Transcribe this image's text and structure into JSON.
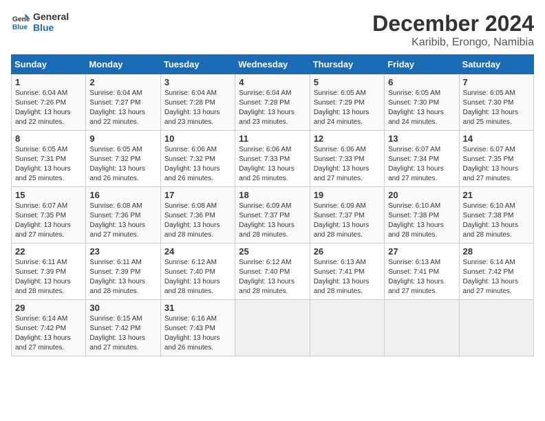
{
  "header": {
    "logo_line1": "General",
    "logo_line2": "Blue",
    "month": "December 2024",
    "location": "Karibib, Erongo, Namibia"
  },
  "weekdays": [
    "Sunday",
    "Monday",
    "Tuesday",
    "Wednesday",
    "Thursday",
    "Friday",
    "Saturday"
  ],
  "weeks": [
    [
      {
        "day": "1",
        "info": "Sunrise: 6:04 AM\nSunset: 7:26 PM\nDaylight: 13 hours\nand 22 minutes."
      },
      {
        "day": "2",
        "info": "Sunrise: 6:04 AM\nSunset: 7:27 PM\nDaylight: 13 hours\nand 22 minutes."
      },
      {
        "day": "3",
        "info": "Sunrise: 6:04 AM\nSunset: 7:28 PM\nDaylight: 13 hours\nand 23 minutes."
      },
      {
        "day": "4",
        "info": "Sunrise: 6:04 AM\nSunset: 7:28 PM\nDaylight: 13 hours\nand 23 minutes."
      },
      {
        "day": "5",
        "info": "Sunrise: 6:05 AM\nSunset: 7:29 PM\nDaylight: 13 hours\nand 24 minutes."
      },
      {
        "day": "6",
        "info": "Sunrise: 6:05 AM\nSunset: 7:30 PM\nDaylight: 13 hours\nand 24 minutes."
      },
      {
        "day": "7",
        "info": "Sunrise: 6:05 AM\nSunset: 7:30 PM\nDaylight: 13 hours\nand 25 minutes."
      }
    ],
    [
      {
        "day": "8",
        "info": "Sunrise: 6:05 AM\nSunset: 7:31 PM\nDaylight: 13 hours\nand 25 minutes."
      },
      {
        "day": "9",
        "info": "Sunrise: 6:05 AM\nSunset: 7:32 PM\nDaylight: 13 hours\nand 26 minutes."
      },
      {
        "day": "10",
        "info": "Sunrise: 6:06 AM\nSunset: 7:32 PM\nDaylight: 13 hours\nand 26 minutes."
      },
      {
        "day": "11",
        "info": "Sunrise: 6:06 AM\nSunset: 7:33 PM\nDaylight: 13 hours\nand 26 minutes."
      },
      {
        "day": "12",
        "info": "Sunrise: 6:06 AM\nSunset: 7:33 PM\nDaylight: 13 hours\nand 27 minutes."
      },
      {
        "day": "13",
        "info": "Sunrise: 6:07 AM\nSunset: 7:34 PM\nDaylight: 13 hours\nand 27 minutes."
      },
      {
        "day": "14",
        "info": "Sunrise: 6:07 AM\nSunset: 7:35 PM\nDaylight: 13 hours\nand 27 minutes."
      }
    ],
    [
      {
        "day": "15",
        "info": "Sunrise: 6:07 AM\nSunset: 7:35 PM\nDaylight: 13 hours\nand 27 minutes."
      },
      {
        "day": "16",
        "info": "Sunrise: 6:08 AM\nSunset: 7:36 PM\nDaylight: 13 hours\nand 27 minutes."
      },
      {
        "day": "17",
        "info": "Sunrise: 6:08 AM\nSunset: 7:36 PM\nDaylight: 13 hours\nand 28 minutes."
      },
      {
        "day": "18",
        "info": "Sunrise: 6:09 AM\nSunset: 7:37 PM\nDaylight: 13 hours\nand 28 minutes."
      },
      {
        "day": "19",
        "info": "Sunrise: 6:09 AM\nSunset: 7:37 PM\nDaylight: 13 hours\nand 28 minutes."
      },
      {
        "day": "20",
        "info": "Sunrise: 6:10 AM\nSunset: 7:38 PM\nDaylight: 13 hours\nand 28 minutes."
      },
      {
        "day": "21",
        "info": "Sunrise: 6:10 AM\nSunset: 7:38 PM\nDaylight: 13 hours\nand 28 minutes."
      }
    ],
    [
      {
        "day": "22",
        "info": "Sunrise: 6:11 AM\nSunset: 7:39 PM\nDaylight: 13 hours\nand 28 minutes."
      },
      {
        "day": "23",
        "info": "Sunrise: 6:11 AM\nSunset: 7:39 PM\nDaylight: 13 hours\nand 28 minutes."
      },
      {
        "day": "24",
        "info": "Sunrise: 6:12 AM\nSunset: 7:40 PM\nDaylight: 13 hours\nand 28 minutes."
      },
      {
        "day": "25",
        "info": "Sunrise: 6:12 AM\nSunset: 7:40 PM\nDaylight: 13 hours\nand 28 minutes."
      },
      {
        "day": "26",
        "info": "Sunrise: 6:13 AM\nSunset: 7:41 PM\nDaylight: 13 hours\nand 28 minutes."
      },
      {
        "day": "27",
        "info": "Sunrise: 6:13 AM\nSunset: 7:41 PM\nDaylight: 13 hours\nand 27 minutes."
      },
      {
        "day": "28",
        "info": "Sunrise: 6:14 AM\nSunset: 7:42 PM\nDaylight: 13 hours\nand 27 minutes."
      }
    ],
    [
      {
        "day": "29",
        "info": "Sunrise: 6:14 AM\nSunset: 7:42 PM\nDaylight: 13 hours\nand 27 minutes."
      },
      {
        "day": "30",
        "info": "Sunrise: 6:15 AM\nSunset: 7:42 PM\nDaylight: 13 hours\nand 27 minutes."
      },
      {
        "day": "31",
        "info": "Sunrise: 6:16 AM\nSunset: 7:43 PM\nDaylight: 13 hours\nand 26 minutes."
      },
      {
        "day": "",
        "info": ""
      },
      {
        "day": "",
        "info": ""
      },
      {
        "day": "",
        "info": ""
      },
      {
        "day": "",
        "info": ""
      }
    ]
  ]
}
